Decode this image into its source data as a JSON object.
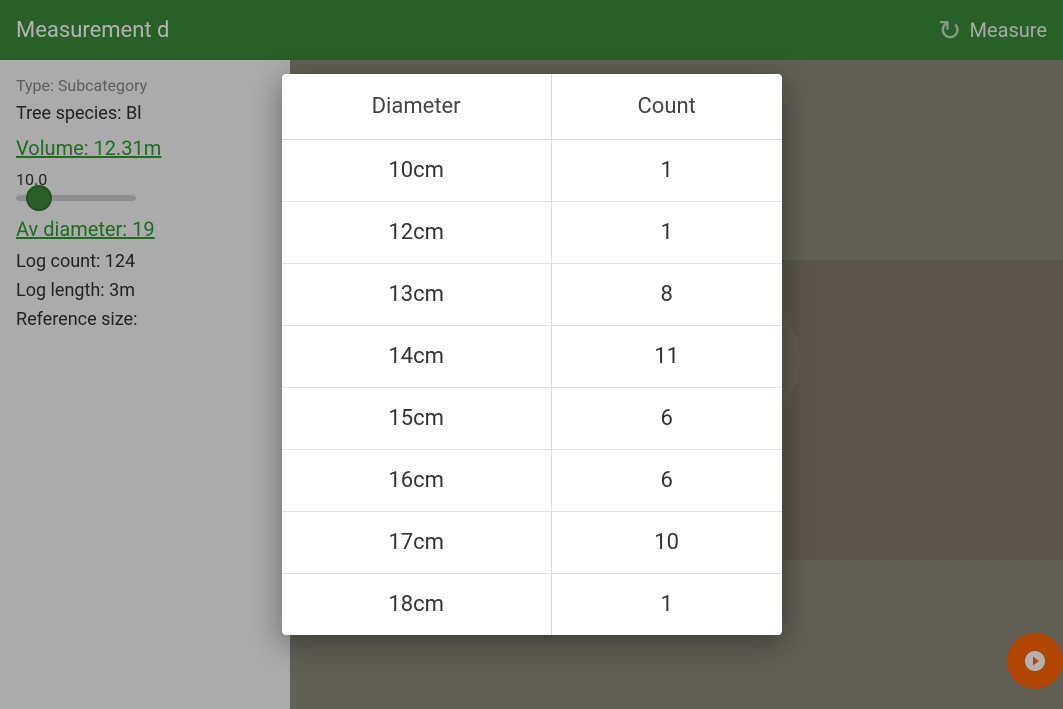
{
  "header": {
    "title": "Measurement d",
    "refresh_label": "Measure",
    "refresh_icon": "↻"
  },
  "left_panel": {
    "type_label": "Type: Subcategory",
    "species_label": "Tree species: Bl",
    "volume_label": "Volume:",
    "volume_value": "12.31m",
    "slider_value": "10.0",
    "av_diameter_label": "Av diameter:",
    "av_diameter_value": "19",
    "log_count": "Log count: 124",
    "log_length": "Log length: 3m",
    "ref_size": "Reference size:"
  },
  "table": {
    "col_diameter": "Diameter",
    "col_count": "Count",
    "rows": [
      {
        "diameter": "10cm",
        "count": "1"
      },
      {
        "diameter": "12cm",
        "count": "1"
      },
      {
        "diameter": "13cm",
        "count": "8"
      },
      {
        "diameter": "14cm",
        "count": "11"
      },
      {
        "diameter": "15cm",
        "count": "6"
      },
      {
        "diameter": "16cm",
        "count": "6"
      },
      {
        "diameter": "17cm",
        "count": "10"
      },
      {
        "diameter": "18cm",
        "count": "1"
      }
    ]
  }
}
